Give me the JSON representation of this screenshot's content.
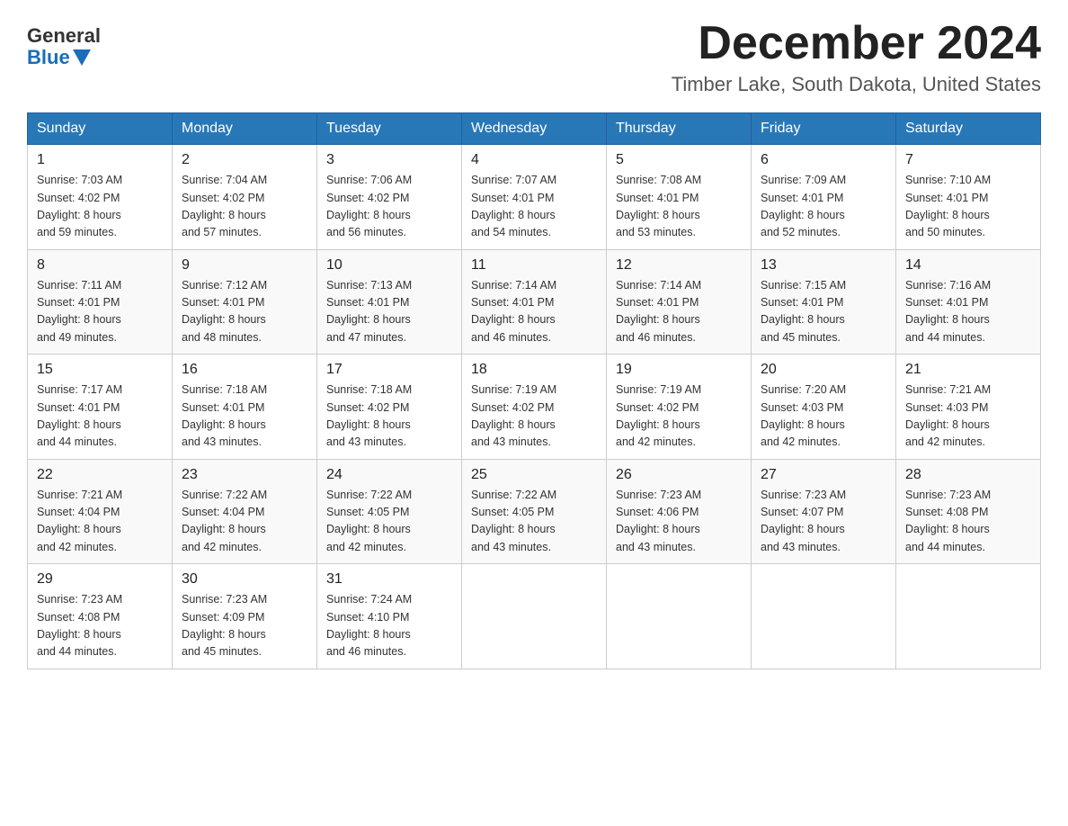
{
  "logo": {
    "general_text": "General",
    "blue_text": "Blue"
  },
  "title": "December 2024",
  "location": "Timber Lake, South Dakota, United States",
  "days_of_week": [
    "Sunday",
    "Monday",
    "Tuesday",
    "Wednesday",
    "Thursday",
    "Friday",
    "Saturday"
  ],
  "weeks": [
    [
      {
        "day": "1",
        "sunrise": "7:03 AM",
        "sunset": "4:02 PM",
        "daylight": "8 hours and 59 minutes."
      },
      {
        "day": "2",
        "sunrise": "7:04 AM",
        "sunset": "4:02 PM",
        "daylight": "8 hours and 57 minutes."
      },
      {
        "day": "3",
        "sunrise": "7:06 AM",
        "sunset": "4:02 PM",
        "daylight": "8 hours and 56 minutes."
      },
      {
        "day": "4",
        "sunrise": "7:07 AM",
        "sunset": "4:01 PM",
        "daylight": "8 hours and 54 minutes."
      },
      {
        "day": "5",
        "sunrise": "7:08 AM",
        "sunset": "4:01 PM",
        "daylight": "8 hours and 53 minutes."
      },
      {
        "day": "6",
        "sunrise": "7:09 AM",
        "sunset": "4:01 PM",
        "daylight": "8 hours and 52 minutes."
      },
      {
        "day": "7",
        "sunrise": "7:10 AM",
        "sunset": "4:01 PM",
        "daylight": "8 hours and 50 minutes."
      }
    ],
    [
      {
        "day": "8",
        "sunrise": "7:11 AM",
        "sunset": "4:01 PM",
        "daylight": "8 hours and 49 minutes."
      },
      {
        "day": "9",
        "sunrise": "7:12 AM",
        "sunset": "4:01 PM",
        "daylight": "8 hours and 48 minutes."
      },
      {
        "day": "10",
        "sunrise": "7:13 AM",
        "sunset": "4:01 PM",
        "daylight": "8 hours and 47 minutes."
      },
      {
        "day": "11",
        "sunrise": "7:14 AM",
        "sunset": "4:01 PM",
        "daylight": "8 hours and 46 minutes."
      },
      {
        "day": "12",
        "sunrise": "7:14 AM",
        "sunset": "4:01 PM",
        "daylight": "8 hours and 46 minutes."
      },
      {
        "day": "13",
        "sunrise": "7:15 AM",
        "sunset": "4:01 PM",
        "daylight": "8 hours and 45 minutes."
      },
      {
        "day": "14",
        "sunrise": "7:16 AM",
        "sunset": "4:01 PM",
        "daylight": "8 hours and 44 minutes."
      }
    ],
    [
      {
        "day": "15",
        "sunrise": "7:17 AM",
        "sunset": "4:01 PM",
        "daylight": "8 hours and 44 minutes."
      },
      {
        "day": "16",
        "sunrise": "7:18 AM",
        "sunset": "4:01 PM",
        "daylight": "8 hours and 43 minutes."
      },
      {
        "day": "17",
        "sunrise": "7:18 AM",
        "sunset": "4:02 PM",
        "daylight": "8 hours and 43 minutes."
      },
      {
        "day": "18",
        "sunrise": "7:19 AM",
        "sunset": "4:02 PM",
        "daylight": "8 hours and 43 minutes."
      },
      {
        "day": "19",
        "sunrise": "7:19 AM",
        "sunset": "4:02 PM",
        "daylight": "8 hours and 42 minutes."
      },
      {
        "day": "20",
        "sunrise": "7:20 AM",
        "sunset": "4:03 PM",
        "daylight": "8 hours and 42 minutes."
      },
      {
        "day": "21",
        "sunrise": "7:21 AM",
        "sunset": "4:03 PM",
        "daylight": "8 hours and 42 minutes."
      }
    ],
    [
      {
        "day": "22",
        "sunrise": "7:21 AM",
        "sunset": "4:04 PM",
        "daylight": "8 hours and 42 minutes."
      },
      {
        "day": "23",
        "sunrise": "7:22 AM",
        "sunset": "4:04 PM",
        "daylight": "8 hours and 42 minutes."
      },
      {
        "day": "24",
        "sunrise": "7:22 AM",
        "sunset": "4:05 PM",
        "daylight": "8 hours and 42 minutes."
      },
      {
        "day": "25",
        "sunrise": "7:22 AM",
        "sunset": "4:05 PM",
        "daylight": "8 hours and 43 minutes."
      },
      {
        "day": "26",
        "sunrise": "7:23 AM",
        "sunset": "4:06 PM",
        "daylight": "8 hours and 43 minutes."
      },
      {
        "day": "27",
        "sunrise": "7:23 AM",
        "sunset": "4:07 PM",
        "daylight": "8 hours and 43 minutes."
      },
      {
        "day": "28",
        "sunrise": "7:23 AM",
        "sunset": "4:08 PM",
        "daylight": "8 hours and 44 minutes."
      }
    ],
    [
      {
        "day": "29",
        "sunrise": "7:23 AM",
        "sunset": "4:08 PM",
        "daylight": "8 hours and 44 minutes."
      },
      {
        "day": "30",
        "sunrise": "7:23 AM",
        "sunset": "4:09 PM",
        "daylight": "8 hours and 45 minutes."
      },
      {
        "day": "31",
        "sunrise": "7:24 AM",
        "sunset": "4:10 PM",
        "daylight": "8 hours and 46 minutes."
      },
      null,
      null,
      null,
      null
    ]
  ],
  "labels": {
    "sunrise": "Sunrise:",
    "sunset": "Sunset:",
    "daylight": "Daylight:"
  }
}
